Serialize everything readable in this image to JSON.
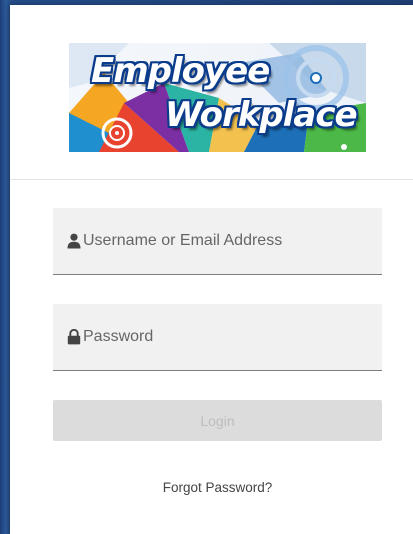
{
  "logo": {
    "line1": "Employee",
    "line2": "Workplace",
    "colors": {
      "text": "#ffffff",
      "outline": "#0b3c8c"
    }
  },
  "form": {
    "username": {
      "placeholder": "Username or Email Address",
      "value": "",
      "icon": "user-icon"
    },
    "password": {
      "placeholder": "Password",
      "value": "",
      "icon": "lock-icon"
    },
    "login_label": "Login",
    "login_state": "disabled",
    "forgot_label": "Forgot Password?"
  },
  "colors": {
    "background": "#2a4f8a",
    "card": "#ffffff",
    "field": "#f1f1f1",
    "button_disabled": "#dcdcdc"
  }
}
